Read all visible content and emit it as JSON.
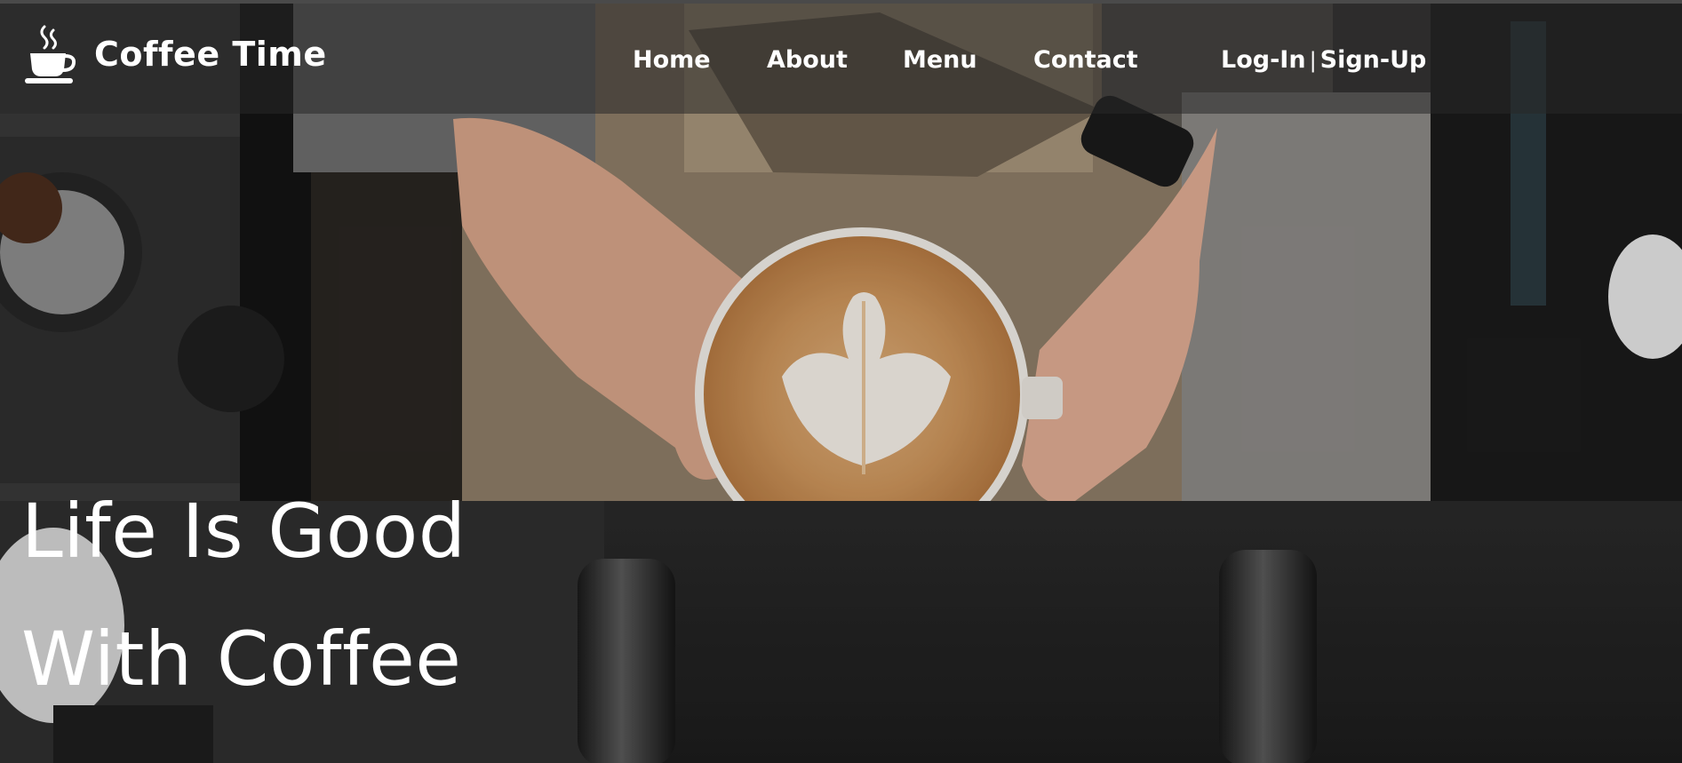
{
  "brand": {
    "name": "Coffee Time",
    "logo_icon": "coffee-cup-icon"
  },
  "nav": {
    "items": [
      {
        "label": "Home"
      },
      {
        "label": "About"
      },
      {
        "label": "Menu"
      },
      {
        "label": "Contact"
      }
    ]
  },
  "auth": {
    "login_label": "Log-In",
    "separator": "|",
    "signup_label": "Sign-Up"
  },
  "hero": {
    "headline_line1": "Life Is Good",
    "headline_line2": "With Coffee",
    "image_subject": "barista hands holding latte art cup"
  },
  "colors": {
    "text": "#ffffff",
    "navbar_overlay": "rgba(40,40,40,0.55)",
    "latte": "#c98f57",
    "apron": "#9c8a73"
  }
}
